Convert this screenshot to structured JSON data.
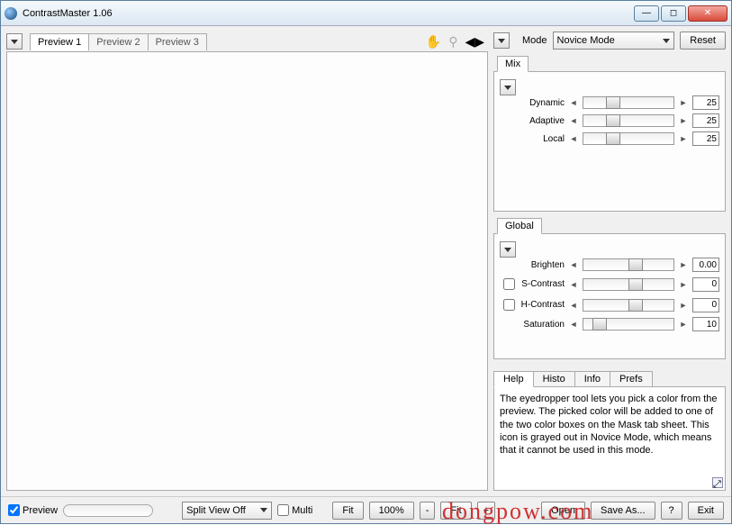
{
  "window": {
    "title": "ContrastMaster 1.06"
  },
  "preview_tabs": [
    "Preview 1",
    "Preview 2",
    "Preview 3"
  ],
  "mode": {
    "label": "Mode",
    "selected": "Novice Mode",
    "reset": "Reset"
  },
  "mix": {
    "tab": "Mix",
    "sliders": [
      {
        "label": "Dynamic",
        "value": "25",
        "pos": 25
      },
      {
        "label": "Adaptive",
        "value": "25",
        "pos": 25
      },
      {
        "label": "Local",
        "value": "25",
        "pos": 25
      }
    ]
  },
  "global": {
    "tab": "Global",
    "sliders": [
      {
        "label": "Brighten",
        "value": "0.00",
        "pos": 50,
        "check": false
      },
      {
        "label": "S-Contrast",
        "value": "0",
        "pos": 50,
        "check": true
      },
      {
        "label": "H-Contrast",
        "value": "0",
        "pos": 50,
        "check": true
      },
      {
        "label": "Saturation",
        "value": "10",
        "pos": 10,
        "check": false
      }
    ]
  },
  "help": {
    "tabs": [
      "Help",
      "Histo",
      "Info",
      "Prefs"
    ],
    "text": "The eyedropper tool lets you pick a color from the preview. The picked color will be added to one of the two color boxes on the Mask tab sheet. This icon is grayed out in Novice Mode, which means that it cannot be used in this mode."
  },
  "footer": {
    "preview": "Preview",
    "split": "Split View Off",
    "multi": "Multi",
    "fit1": "Fit",
    "zoom": "100%",
    "minus": "-",
    "fit2": "Fit",
    "plus": "+",
    "open": "Open",
    "saveas": "Save As...",
    "q": "?",
    "exit": "Exit"
  },
  "watermark": "dongpow.com"
}
